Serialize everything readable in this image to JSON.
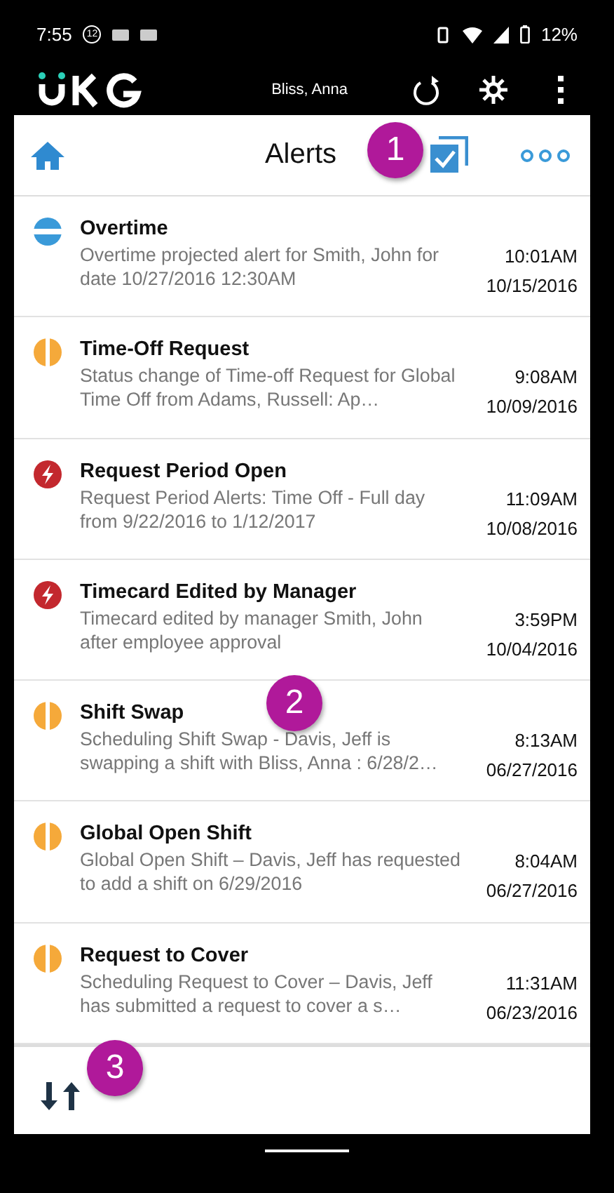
{
  "status_bar": {
    "time": "7:55",
    "notification_badge": "12",
    "battery": "12%"
  },
  "header": {
    "user": "Bliss, Anna"
  },
  "toolbar": {
    "title": "Alerts"
  },
  "alerts": [
    {
      "kind": "info",
      "title": "Overtime",
      "description": "Overtime projected alert for Smith, John for date 10/27/2016 12:30AM",
      "time": "10:01AM",
      "date": "10/15/2016"
    },
    {
      "kind": "pending",
      "title": "Time-Off Request",
      "description": "Status change of Time-off Request for Global Time Off from Adams, Russell: Ap…",
      "time": "9:08AM",
      "date": "10/09/2016"
    },
    {
      "kind": "urgent",
      "title": "Request Period Open",
      "description": "Request Period Alerts: Time Off - Full day from 9/22/2016 to 1/12/2017",
      "time": "11:09AM",
      "date": "10/08/2016"
    },
    {
      "kind": "urgent",
      "title": "Timecard Edited by Manager",
      "description": "Timecard edited by manager Smith, John after employee approval",
      "time": "3:59PM",
      "date": "10/04/2016"
    },
    {
      "kind": "pending",
      "title": "Shift Swap",
      "description": "Scheduling Shift Swap - Davis, Jeff is swapping a shift with Bliss, Anna : 6/28/2…",
      "time": "8:13AM",
      "date": "06/27/2016"
    },
    {
      "kind": "pending",
      "title": "Global Open Shift",
      "description": "Global Open Shift –   Davis, Jeff has requested to add a shift on 6/29/2016",
      "time": "8:04AM",
      "date": "06/27/2016"
    },
    {
      "kind": "pending",
      "title": "Request to Cover",
      "description": "Scheduling Request to Cover  –   Davis, Jeff has submitted a request to cover a s…",
      "time": "11:31AM",
      "date": "06/23/2016"
    }
  ],
  "callouts": [
    "1",
    "2",
    "3"
  ]
}
